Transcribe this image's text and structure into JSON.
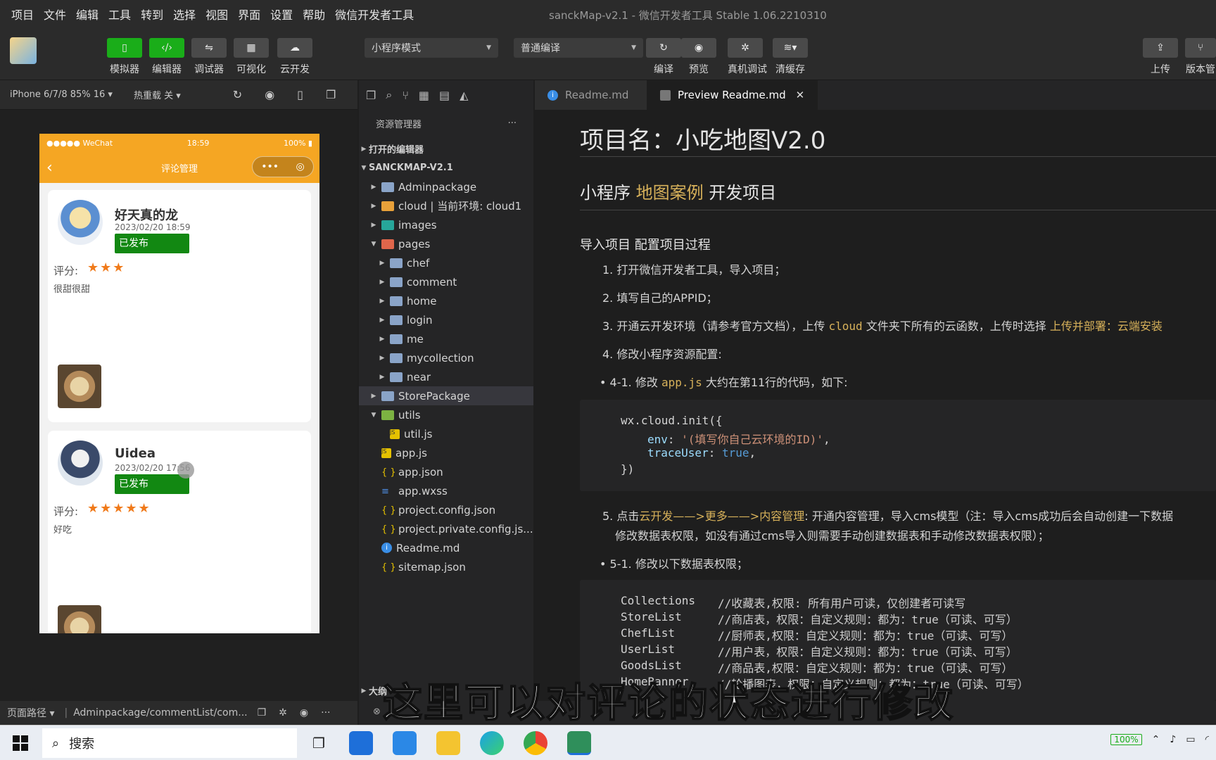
{
  "menu": [
    "项目",
    "文件",
    "编辑",
    "工具",
    "转到",
    "选择",
    "视图",
    "界面",
    "设置",
    "帮助",
    "微信开发者工具"
  ],
  "window_title": "sanckMap-v2.1 - 微信开发者工具 Stable 1.06.2210310",
  "toolbar": {
    "simulator": "模拟器",
    "editor": "编辑器",
    "debugger": "调试器",
    "visual": "可视化",
    "cloud": "云开发",
    "mode": "小程序模式",
    "compile_mode": "普通编译",
    "compile": "编译",
    "preview": "预览",
    "real_debug": "真机调试",
    "clear_cache": "清缓存",
    "upload": "上传",
    "version": "版本管"
  },
  "sim_bar": {
    "device": "iPhone 6/7/8 85% 16",
    "hot_reload": "热重载 关"
  },
  "phone": {
    "carrier": "●●●●● WeChat",
    "time": "18:59",
    "battery": "100%",
    "nav_title": "评论管理",
    "capsule_more": "•••",
    "capsule_close": "◎",
    "cards": [
      {
        "name": "好天真的龙",
        "date": "2023/02/20 18:59",
        "status": "已发布",
        "score_label": "评分:",
        "stars": "★★★",
        "comment": "很甜很甜"
      },
      {
        "name": "Uidea",
        "date": "2023/02/20 17:56",
        "status": "已发布",
        "score_label": "评分:",
        "stars": "★★★★★",
        "comment": "好吃"
      }
    ]
  },
  "explorer": {
    "title": "资源管理器",
    "more": "···",
    "open_editors": "打开的编辑器",
    "project": "SANCKMAP-V2.1",
    "items": [
      "Adminpackage",
      "cloud | 当前环境: cloud1",
      "images",
      "pages",
      "chef",
      "comment",
      "home",
      "login",
      "me",
      "mycollection",
      "near",
      "StorePackage",
      "utils",
      "util.js",
      "app.js",
      "app.json",
      "app.wxss",
      "project.config.json",
      "project.private.config.js...",
      "Readme.md",
      "sitemap.json"
    ],
    "outline": "大纲"
  },
  "tabs": {
    "readme": "Readme.md",
    "preview": "Preview Readme.md"
  },
  "doc": {
    "h1": "项目名：小吃地图V2.0",
    "h2_pre": "小程序 ",
    "h2_accent": "地图案例",
    "h2_post": " 开发项目",
    "h3": "导入项目 配置项目过程",
    "step1": "1. 打开微信开发者工具，导入项目；",
    "step2": "2. 填写自己的APPID；",
    "step3_pre": "3. 开通云开发环境（请参考官方文档），上传 ",
    "step3_code": "cloud",
    "step3_mid": " 文件夹下所有的云函数，上传时选择 ",
    "step3_accent": "上传并部署：云端安装",
    "step4": "4. 修改小程序资源配置:",
    "step41_pre": "4-1. 修改 ",
    "step41_code": "app.js",
    "step41_post": " 大约在第11行的代码，如下:",
    "code1_l1": "wx.cloud.init({",
    "code1_env_key": "env",
    "code1_env_val": "'(填写你自己云环境的ID)'",
    "code1_trace_key": "traceUser",
    "code1_trace_val": "true",
    "code1_l4": "})",
    "step5_pre": "5. 点击",
    "step5_a1": "云开发",
    "step5_arrow1": "——>",
    "step5_a2": "更多",
    "step5_arrow2": "——>",
    "step5_a3": "内容管理",
    "step5_post": ": 开通内容管理，导入cms模型（注：导入cms成功后会自动创建一下数据",
    "step5_line2": "修改数据表权限，如没有通过cms导入则需要手动创建数据表和手动修改数据表权限）；",
    "step51": "5-1. 修改以下数据表权限；",
    "code2": [
      {
        "name": "Collections",
        "comment": "//收藏表,权限: 所有用户可读，仅创建者可读写"
      },
      {
        "name": "StoreList",
        "comment": "//商店表，权限：自定义规则：都为：true（可读、可写）"
      },
      {
        "name": "ChefList",
        "comment": "//厨师表,权限：自定义规则：都为：true（可读、可写）"
      },
      {
        "name": "UserList",
        "comment": "//用户表，权限：自定义规则：都为：true（可读、可写）"
      },
      {
        "name": "GoodsList",
        "comment": "//商品表,权限：自定义规则：都为：true（可读、可写）"
      },
      {
        "name": "HomeBanner",
        "comment": "//轮播图表，权限：自定义规则：都为：true（可读、可写）"
      }
    ]
  },
  "sim_bottom": {
    "path_label": "页面路径",
    "path": "Adminpackage/commentList/com..."
  },
  "subtitle": "这里可以对评论的状态进行修改",
  "taskbar": {
    "search": "搜索",
    "battery": "100%"
  }
}
